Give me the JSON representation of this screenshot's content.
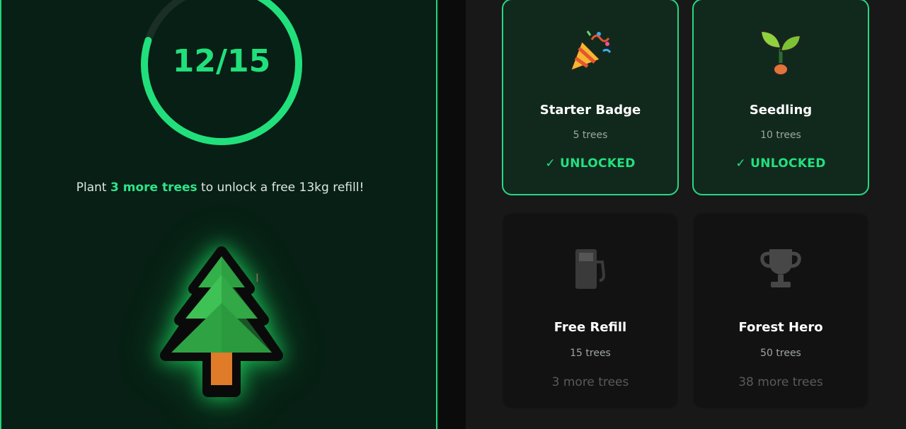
{
  "progress": {
    "label": "12/15",
    "current": 12,
    "target": 15,
    "message_prefix": "Plant ",
    "message_highlight": "3 more trees",
    "message_suffix": " to unlock a free 13kg refill!"
  },
  "colors": {
    "accent": "#21e07c",
    "panel_bg": "#071f14",
    "card_unlocked_bg": "#11291d",
    "card_locked_bg": "#121212"
  },
  "badges": [
    {
      "title": "Starter Badge",
      "requirement": "5 trees",
      "status": "✓ UNLOCKED",
      "icon": "party-popper-icon",
      "unlocked": true
    },
    {
      "title": "Seedling",
      "requirement": "10 trees",
      "status": "✓ UNLOCKED",
      "icon": "sprout-icon",
      "unlocked": true
    },
    {
      "title": "Free Refill",
      "requirement": "15 trees",
      "remaining": "3 more trees",
      "icon": "fuel-pump-icon",
      "unlocked": false
    },
    {
      "title": "Forest Hero",
      "requirement": "50 trees",
      "remaining": "38 more trees",
      "icon": "trophy-icon",
      "unlocked": false
    }
  ]
}
